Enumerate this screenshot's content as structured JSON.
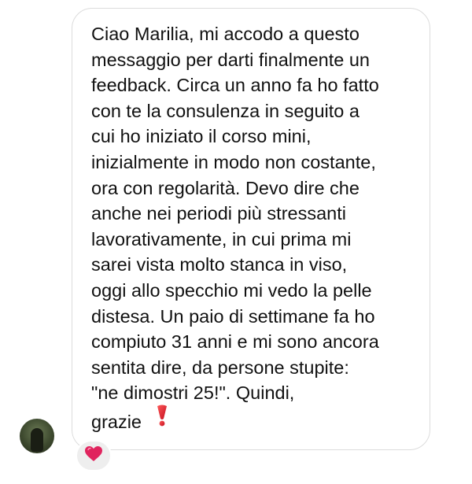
{
  "message": {
    "lines": [
      "Ciao Marilia, mi accodo a questo",
      "messaggio per darti finalmente un",
      "feedback. Circa un anno fa ho fatto",
      "con te la consulenza in seguito a",
      "cui ho iniziato il corso mini,",
      "inizialmente in modo non costante,",
      "ora con regolarità. Devo dire che",
      "anche nei periodi più stressanti",
      "lavorativamente, in cui prima mi",
      "sarei vista molto stanca in viso,",
      "oggi allo specchio mi vedo la pelle",
      "distesa. Un paio di settimane fa ho",
      "compiuto 31 anni e mi sono ancora",
      "sentita dire, da persone stupite:",
      "\"ne dimostri 25!\". Quindi,",
      "grazie"
    ],
    "trailing_icon": "red-exclamation-icon"
  },
  "sender": {
    "avatar_icon": "user-avatar-photo"
  },
  "reaction": {
    "icon": "red-heart-icon",
    "color": "#e0245e"
  },
  "colors": {
    "bubble_border": "#dcdcdc",
    "text": "#111111",
    "reaction_bg": "#eeeeee",
    "accent_red": "#e0245e"
  }
}
